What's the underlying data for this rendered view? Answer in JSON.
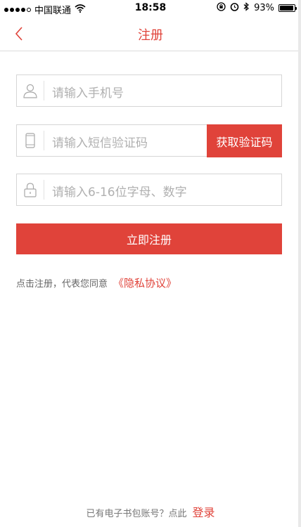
{
  "status_bar": {
    "carrier": "中国联通",
    "time": "18:58",
    "battery": "93%"
  },
  "nav": {
    "title": "注册"
  },
  "form": {
    "phone_placeholder": "请输入手机号",
    "code_placeholder": "请输入短信验证码",
    "get_code_label": "获取验证码",
    "password_placeholder": "请输入6-16位字母、数字",
    "submit_label": "立即注册"
  },
  "agreement": {
    "text": "点击注册，代表您同意",
    "link": "《隐私协议》"
  },
  "footer": {
    "text": "已有电子书包账号？点此",
    "login_link": "登录"
  },
  "colors": {
    "accent": "#e0433a"
  }
}
